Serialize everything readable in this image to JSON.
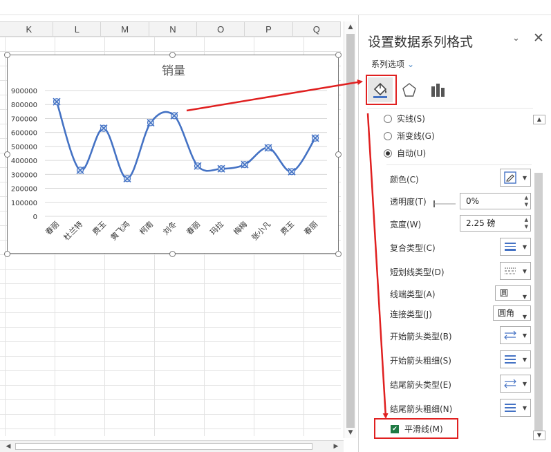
{
  "columns": [
    "K",
    "L",
    "M",
    "N",
    "O",
    "P",
    "Q"
  ],
  "chart": {
    "title": "销量",
    "chart_data": {
      "type": "line",
      "title": "销量",
      "categories": [
        "春丽",
        "杜兰特",
        "费玉",
        "黄飞鸿",
        "柯南",
        "刘冬",
        "春丽",
        "玛拉",
        "梅梅",
        "张小凡",
        "费玉",
        "春丽"
      ],
      "series": [
        {
          "values": [
            820000,
            330000,
            630000,
            270000,
            670000,
            720000,
            360000,
            340000,
            370000,
            490000,
            320000,
            560000
          ]
        }
      ],
      "ylim": [
        0,
        900000
      ],
      "yticks": [
        "900000",
        "800000",
        "700000",
        "600000",
        "500000",
        "400000",
        "300000",
        "200000",
        "100000",
        "0"
      ],
      "smooth": true,
      "marker": "x-circle",
      "line_color": "#4472c4",
      "grid": true
    }
  },
  "panel": {
    "title": "设置数据系列格式",
    "series_options": "系列选项",
    "radios": [
      {
        "label": "实线(S)",
        "checked": false
      },
      {
        "label": "渐变线(G)",
        "checked": false
      },
      {
        "label": "自动(U)",
        "checked": true
      }
    ],
    "color_label": "颜色(C)",
    "transparency_label": "透明度(T)",
    "transparency_value": "0%",
    "width_label": "宽度(W)",
    "width_value": "2.25 磅",
    "compound_label": "复合类型(C)",
    "dash_label": "短划线类型(D)",
    "cap_label": "线端类型(A)",
    "cap_value": "圆",
    "join_label": "连接类型(J)",
    "join_value": "圆角",
    "begin_arrow_type_label": "开始箭头类型(B)",
    "begin_arrow_size_label": "开始箭头粗细(S)",
    "end_arrow_type_label": "结尾箭头类型(E)",
    "end_arrow_size_label": "结尾箭头粗细(N)",
    "smooth_label": "平滑线(M)",
    "smooth_checked": true
  },
  "colors": {
    "accent": "#4472c4",
    "annotation": "#e02020",
    "checkbox": "#1f7a44"
  }
}
